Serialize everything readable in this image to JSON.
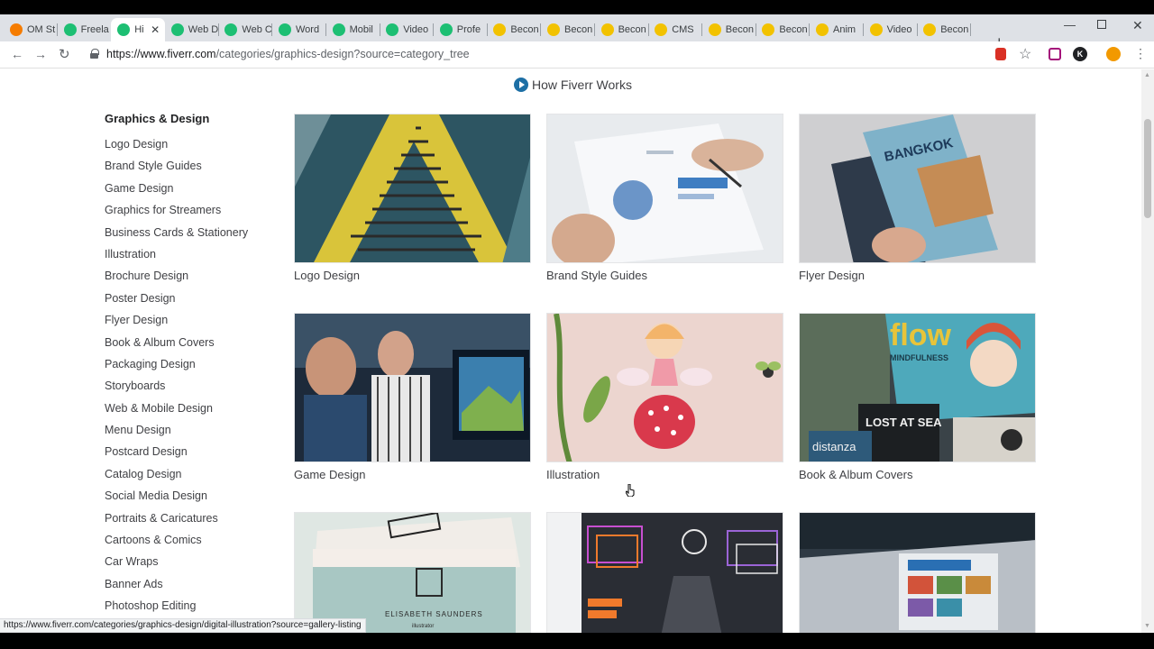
{
  "browser": {
    "tabs": [
      {
        "label": "OM St",
        "favicon": "blogger",
        "color": "#f57c00",
        "active": false
      },
      {
        "label": "Freela",
        "favicon": "fiverr",
        "color": "#1dbf73",
        "active": false
      },
      {
        "label": "Hi",
        "favicon": "fiverr",
        "color": "#1dbf73",
        "active": true
      },
      {
        "label": "Web D",
        "favicon": "fiverr",
        "color": "#1dbf73",
        "active": false
      },
      {
        "label": "Web C",
        "favicon": "fiverr",
        "color": "#1dbf73",
        "active": false
      },
      {
        "label": "Word",
        "favicon": "fiverr",
        "color": "#1dbf73",
        "active": false
      },
      {
        "label": "Mobil",
        "favicon": "fiverr",
        "color": "#1dbf73",
        "active": false
      },
      {
        "label": "Video",
        "favicon": "fiverr",
        "color": "#1dbf73",
        "active": false
      },
      {
        "label": "Profe",
        "favicon": "fiverr",
        "color": "#1dbf73",
        "active": false
      },
      {
        "label": "Becon",
        "favicon": "smiley",
        "color": "#f2c200",
        "active": false
      },
      {
        "label": "Becon",
        "favicon": "smiley",
        "color": "#f2c200",
        "active": false
      },
      {
        "label": "Becon",
        "favicon": "smiley",
        "color": "#f2c200",
        "active": false
      },
      {
        "label": "CMS",
        "favicon": "smiley",
        "color": "#f2c200",
        "active": false
      },
      {
        "label": "Becon",
        "favicon": "smiley",
        "color": "#f2c200",
        "active": false
      },
      {
        "label": "Becon",
        "favicon": "smiley",
        "color": "#f2c200",
        "active": false
      },
      {
        "label": "Anim",
        "favicon": "smiley",
        "color": "#f2c200",
        "active": false
      },
      {
        "label": "Video",
        "favicon": "smiley",
        "color": "#f2c200",
        "active": false
      },
      {
        "label": "Becon",
        "favicon": "smiley",
        "color": "#f2c200",
        "active": false
      }
    ],
    "new_tab": "+",
    "close_tab": "✕",
    "url_host": "https://www.fiverr.com",
    "url_path": "/categories/graphics-design?source=category_tree",
    "profile_initial": "K",
    "status_url": "https://www.fiverr.com/categories/graphics-design/digital-illustration?source=gallery-listing"
  },
  "page": {
    "how_it_works": "How Fiverr Works",
    "sidebar": {
      "title": "Graphics & Design",
      "items": [
        "Logo Design",
        "Brand Style Guides",
        "Game Design",
        "Graphics for Streamers",
        "Business Cards & Stationery",
        "Illustration",
        "Brochure Design",
        "Poster Design",
        "Flyer Design",
        "Book & Album Covers",
        "Packaging Design",
        "Storyboards",
        "Web & Mobile Design",
        "Menu Design",
        "Postcard Design",
        "Catalog Design",
        "Social Media Design",
        "Portraits & Caricatures",
        "Cartoons & Comics",
        "Car Wraps",
        "Banner Ads",
        "Photoshop Editing"
      ]
    },
    "cards": [
      {
        "caption": "Logo Design"
      },
      {
        "caption": "Brand Style Guides"
      },
      {
        "caption": "Flyer Design"
      },
      {
        "caption": "Game Design"
      },
      {
        "caption": "Illustration"
      },
      {
        "caption": "Book & Album Covers"
      },
      {
        "caption": ""
      },
      {
        "caption": ""
      },
      {
        "caption": ""
      }
    ],
    "thumb_text": {
      "bangkok": "BANGKOK",
      "flow": "flow",
      "mindfulness": "MINDFULNESS",
      "lost_at_sea": "LOST AT SEA",
      "distanza": "distanza",
      "card_name": "ELISABETH SAUNDERS",
      "card_role": "illustrator"
    }
  }
}
